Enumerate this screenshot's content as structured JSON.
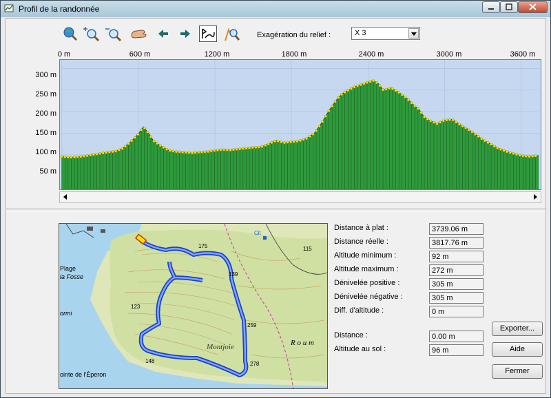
{
  "window": {
    "title": "Profil de la randonnée"
  },
  "toolbar": {
    "buttons": [
      {
        "name": "globe-zoom-icon"
      },
      {
        "name": "zoom-in-icon"
      },
      {
        "name": "zoom-out-icon"
      },
      {
        "name": "pan-hand-icon"
      },
      {
        "name": "arrow-left-icon"
      },
      {
        "name": "arrow-right-icon"
      },
      {
        "name": "profile-fit-icon"
      },
      {
        "name": "hiker-search-icon"
      }
    ],
    "relief_label": "Exagération du relief :",
    "relief_value": "X 3"
  },
  "chart_data": {
    "type": "area",
    "title": "",
    "xlabel": "",
    "ylabel": "",
    "x_ticks": [
      "0 m",
      "600 m",
      "1200 m",
      "1800 m",
      "2400 m",
      "3000 m",
      "3600 m"
    ],
    "y_ticks": [
      "300 m",
      "250 m",
      "200 m",
      "150 m",
      "100 m",
      "50 m"
    ],
    "xlim": [
      0,
      3739
    ],
    "ylim": [
      20,
      320
    ],
    "grid": true,
    "series": [
      {
        "x": [
          0,
          60,
          120,
          180,
          240,
          300,
          360,
          420,
          480,
          540,
          600,
          640,
          680,
          720,
          780,
          840,
          900,
          960,
          1020,
          1080,
          1140,
          1200,
          1260,
          1320,
          1380,
          1440,
          1500,
          1560,
          1620,
          1680,
          1740,
          1800,
          1860,
          1920,
          1980,
          2040,
          2100,
          2160,
          2200,
          2260,
          2300,
          2340,
          2400,
          2440,
          2480,
          2520,
          2580,
          2640,
          2700,
          2760,
          2800,
          2840,
          2880,
          2940,
          3000,
          3060,
          3120,
          3180,
          3240,
          3300,
          3360,
          3420,
          3480,
          3540,
          3600,
          3660,
          3739
        ],
        "y": [
          96,
          94,
          95,
          97,
          100,
          103,
          106,
          108,
          115,
          130,
          148,
          165,
          150,
          132,
          120,
          110,
          107,
          106,
          104,
          106,
          107,
          110,
          112,
          111,
          113,
          115,
          117,
          118,
          125,
          133,
          128,
          130,
          132,
          138,
          150,
          175,
          205,
          230,
          242,
          252,
          258,
          262,
          268,
          272,
          265,
          250,
          255,
          245,
          232,
          215,
          205,
          188,
          180,
          172,
          180,
          182,
          170,
          160,
          148,
          135,
          125,
          115,
          108,
          103,
          98,
          96,
          98
        ]
      }
    ]
  },
  "stats": [
    {
      "label": "Distance à plat :",
      "value": "3739.06 m"
    },
    {
      "label": "Distance réelle :",
      "value": "3817.76 m"
    },
    {
      "label": "Altitude minimum :",
      "value": "92 m"
    },
    {
      "label": "Altitude maximum :",
      "value": "272 m"
    },
    {
      "label": "Dénivelée positive :",
      "value": "305 m"
    },
    {
      "label": "Dénivelée négative :",
      "value": "305 m"
    },
    {
      "label": "Diff. d'altitude :",
      "value": "0 m"
    }
  ],
  "cursor": [
    {
      "label": "Distance :",
      "value": "0.00 m"
    },
    {
      "label": "Altitude au sol :",
      "value": "96 m"
    }
  ],
  "buttons": {
    "export": "Exporter...",
    "help": "Aide",
    "close": "Fermer"
  },
  "map_labels": {
    "plage": "Plage",
    "la_fosse": "la Fosse",
    "ormi": "ormi",
    "pointe": "ointe de l'Éperon",
    "montjoie": "Montjoie",
    "roum": "R o u m",
    "cit": "Cit",
    "alt_175": "175",
    "alt_139": "139",
    "alt_123": "123",
    "alt_259": "259",
    "alt_278": "278",
    "alt_148": "148",
    "alt_115": "115"
  },
  "colors": {
    "profile_fill": "#2e9a3c",
    "profile_bg": "#c6d8f0",
    "track": "#3a64e8",
    "marker": "#ffe600"
  }
}
